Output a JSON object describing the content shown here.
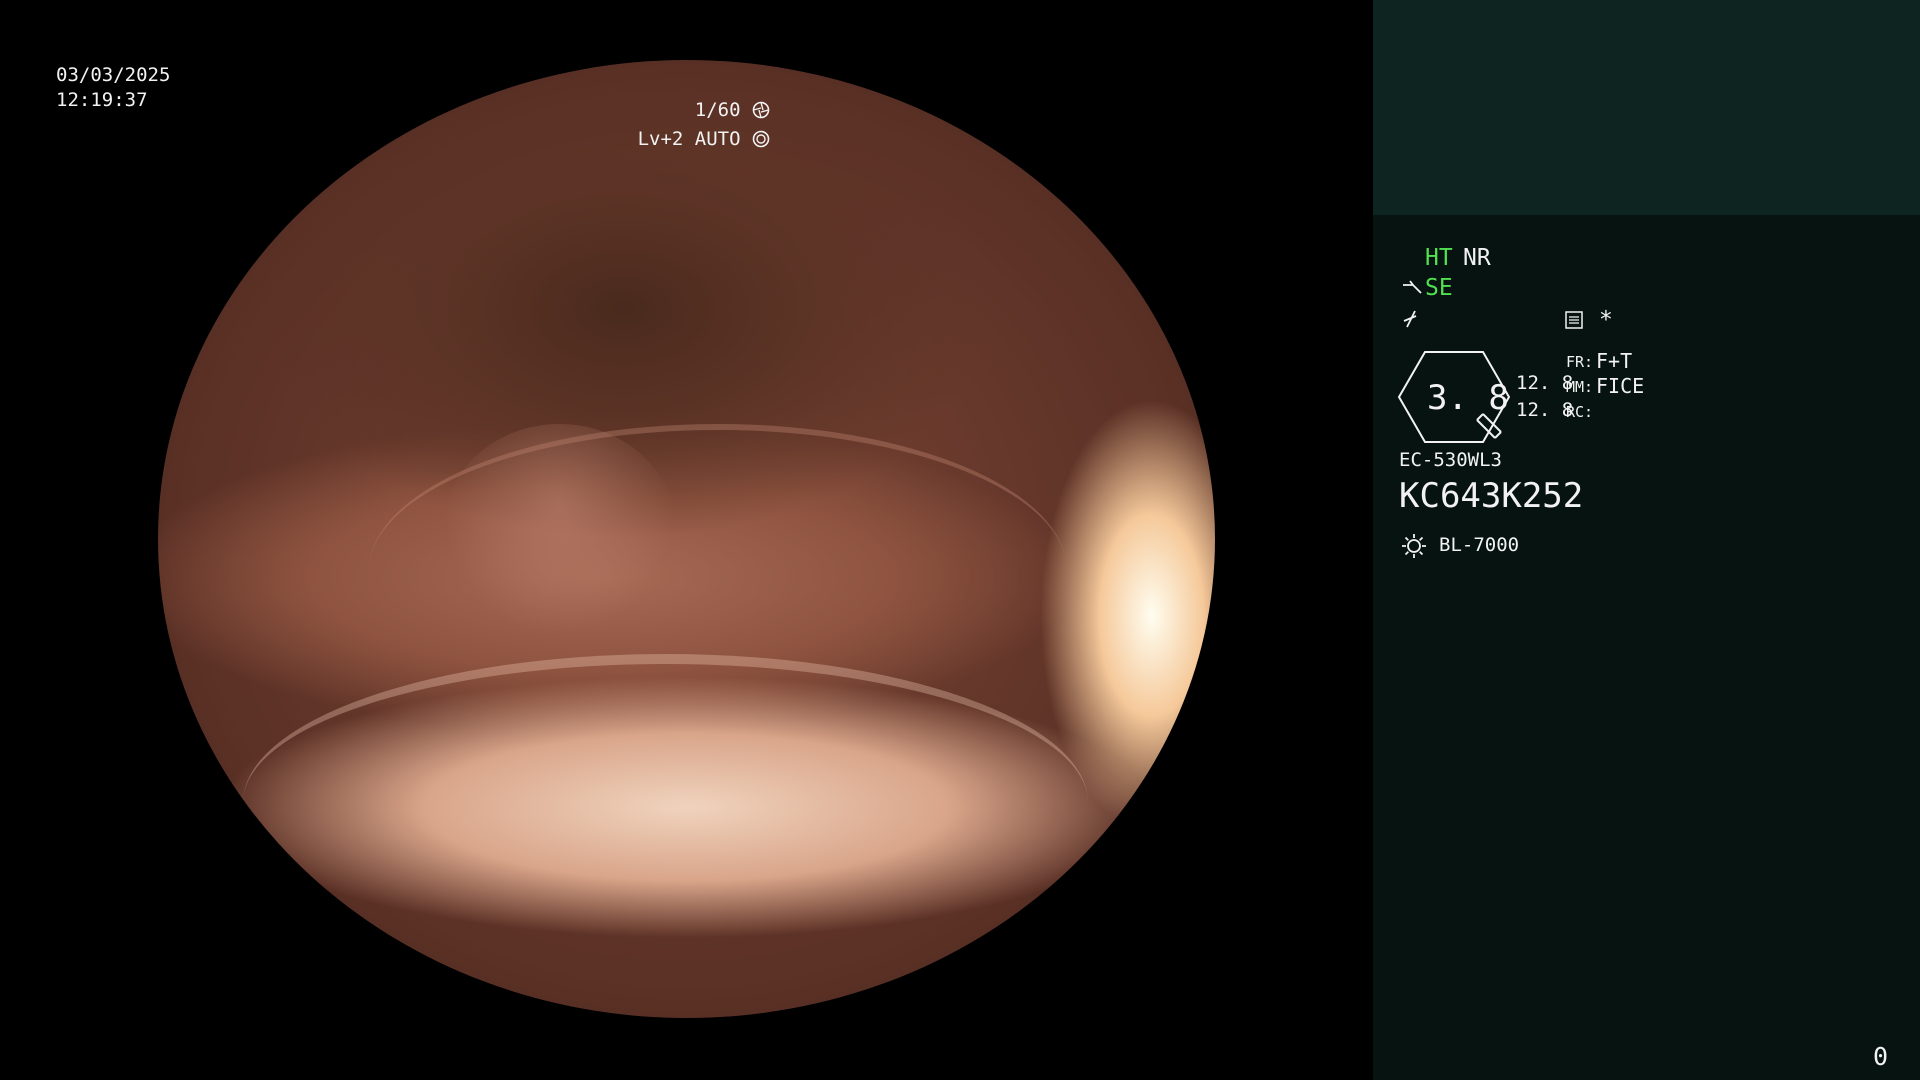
{
  "video": {
    "date": "03/03/2025",
    "time": "12:19:37",
    "shutter": "1/60",
    "shutter_icon": "aperture-icon",
    "level": "Lv+2",
    "exposure_mode": "AUTO",
    "exposure_icon": "iris-icon"
  },
  "panel": {
    "modes": {
      "ht": "HT",
      "nr": "NR",
      "se": "SE",
      "se_icon": "scope-tip-icon",
      "enhance_icon": "enhance-icon",
      "memo_icon": "memo-icon",
      "star": "*"
    },
    "zoom": {
      "value": "3. 8",
      "fr_val_left": "12. 8",
      "mm_val_left": "12. 8",
      "fr_label": "FR:",
      "fr_value": "F+T",
      "mm_label": "MM:",
      "mm_value": "FICE",
      "rc_label": "RC:",
      "rc_value": ""
    },
    "scope_model": "EC-530WL3",
    "scope_serial": "KC643K252",
    "light_icon": "light-source-icon",
    "light_source": "BL-7000",
    "counter": "0"
  },
  "colors": {
    "accent_green": "#50e050",
    "panel_bg": "#061310",
    "panel_top": "#0d2421"
  }
}
